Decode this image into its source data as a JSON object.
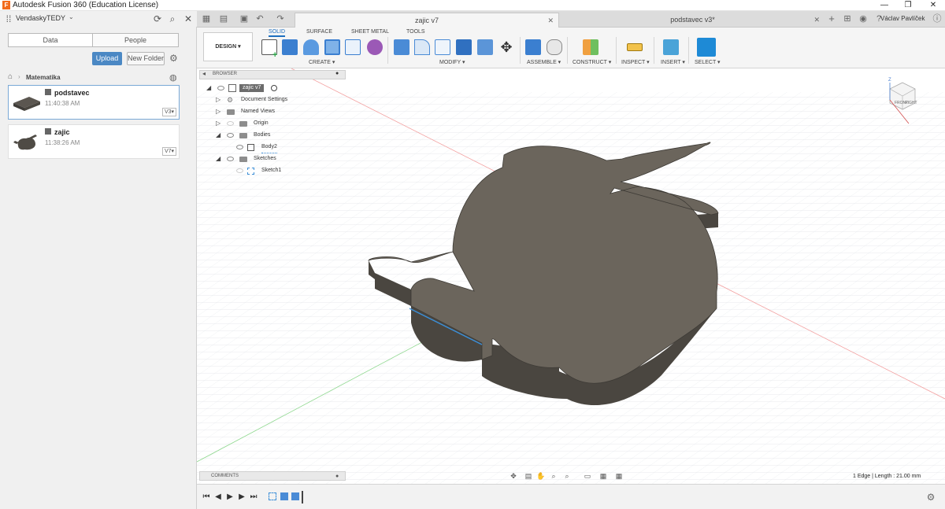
{
  "window": {
    "title": "Autodesk Fusion 360 (Education License)",
    "logo_letter": "F",
    "minimize": "—",
    "maximize": "❐",
    "close": "✕"
  },
  "data_panel": {
    "team": "VendaskyTEDY",
    "tabs": [
      "Data",
      "People"
    ],
    "upload": "Upload",
    "new_folder": "New Folder",
    "breadcrumb": "Matematika",
    "items": [
      {
        "name": "podstavec",
        "time": "11:40:38 AM",
        "version": "V3▾"
      },
      {
        "name": "zajic",
        "time": "11:38:26 AM",
        "version": "V7▾"
      }
    ]
  },
  "tabs": {
    "docs": [
      {
        "label": "zajic v7",
        "active": true
      },
      {
        "label": "podstavec v3*",
        "active": false
      }
    ],
    "plus": "+",
    "user": "Václav Pavlíček"
  },
  "toolbar": {
    "workspace": "DESIGN ▾",
    "ws_tabs": [
      "SOLID",
      "SURFACE",
      "SHEET METAL",
      "TOOLS"
    ],
    "groups": [
      "CREATE ▾",
      "MODIFY ▾",
      "ASSEMBLE ▾",
      "CONSTRUCT ▾",
      "INSPECT ▾",
      "INSERT ▾",
      "SELECT ▾"
    ]
  },
  "browser": {
    "title": "BROWSER",
    "root": "zajic v7",
    "rows": [
      "Document Settings",
      "Named Views",
      "Origin",
      "Bodies",
      "Body2",
      "Sketches",
      "Sketch1"
    ]
  },
  "viewcube": {
    "top": "TOP",
    "front": "FRONT",
    "right": "RIGHT",
    "axis": "Z"
  },
  "comments": "COMMENTS",
  "status": "1 Edge | Length : 21.00 mm",
  "colors": {
    "accent": "#1e6fbf",
    "body": "#6b655c",
    "body_side": "#4f4b44",
    "upload": "#4b88c4"
  }
}
